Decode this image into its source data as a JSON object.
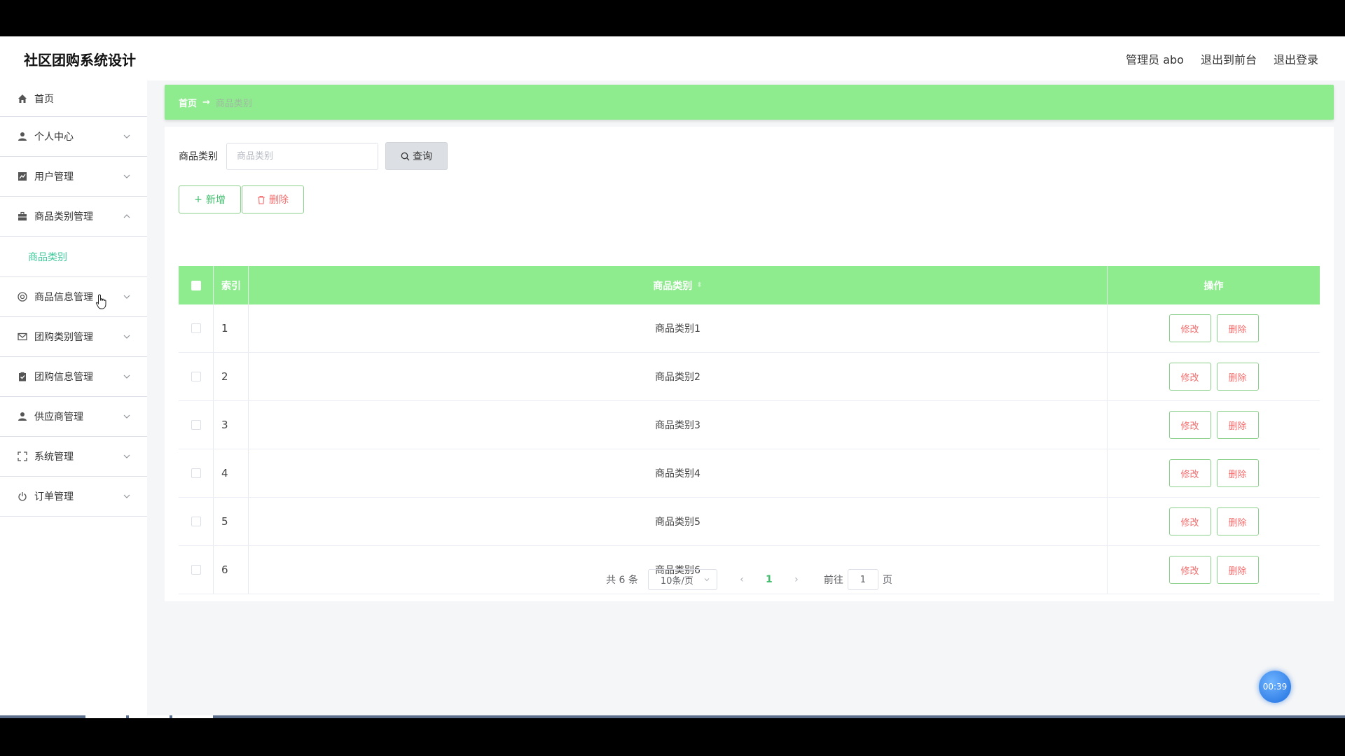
{
  "app": {
    "title": "社区团购系统设计"
  },
  "header": {
    "user_label": "管理员 abo",
    "front_label": "退出到前台",
    "logout_label": "退出登录"
  },
  "sidebar": {
    "items": [
      {
        "label": "首页",
        "icon": "home-icon"
      },
      {
        "label": "个人中心",
        "icon": "user-icon"
      },
      {
        "label": "用户管理",
        "icon": "chart-icon"
      },
      {
        "label": "商品类别管理",
        "icon": "briefcase-icon"
      },
      {
        "label": "商品信息管理",
        "icon": "settings-circle-icon"
      },
      {
        "label": "团购类别管理",
        "icon": "mail-icon"
      },
      {
        "label": "团购信息管理",
        "icon": "clipboard-icon"
      },
      {
        "label": "供应商管理",
        "icon": "user-icon"
      },
      {
        "label": "系统管理",
        "icon": "fullscreen-icon"
      },
      {
        "label": "订单管理",
        "icon": "power-icon"
      }
    ],
    "active_sub": "商品类别"
  },
  "breadcrumb": {
    "home": "首页",
    "current": "商品类别"
  },
  "search": {
    "label": "商品类别",
    "placeholder": "商品类别",
    "button": "查询"
  },
  "actions": {
    "add": "新增",
    "delete": "删除"
  },
  "table": {
    "headers": {
      "index": "索引",
      "name": "商品类别",
      "op": "操作"
    },
    "rows": [
      {
        "index": "1",
        "name": "商品类别1"
      },
      {
        "index": "2",
        "name": "商品类别2"
      },
      {
        "index": "3",
        "name": "商品类别3"
      },
      {
        "index": "4",
        "name": "商品类别4"
      },
      {
        "index": "5",
        "name": "商品类别5"
      },
      {
        "index": "6",
        "name": "商品类别6"
      }
    ],
    "edit_label": "修改",
    "delete_label": "删除"
  },
  "pager": {
    "total": "共 6 条",
    "page_size": "10条/页",
    "current": "1",
    "goto_prefix": "前往",
    "goto_value": "1",
    "goto_suffix": "页"
  },
  "timer": "00:39",
  "colors": {
    "accent": "#8eeb8e",
    "active": "#3ec99b",
    "danger": "#f56c6c"
  }
}
